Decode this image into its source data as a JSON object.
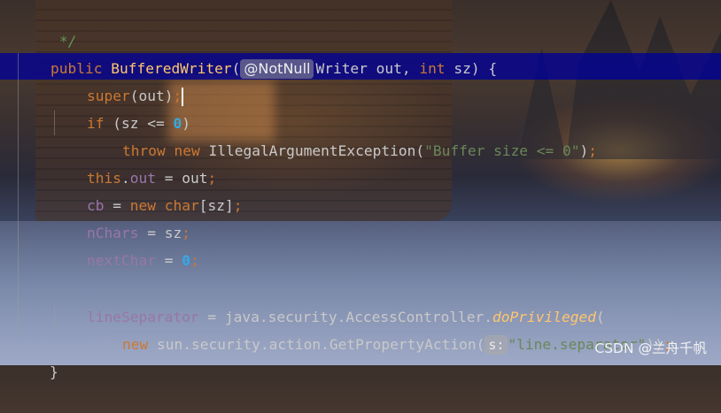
{
  "editor": {
    "comment_end": "*/",
    "line_constructor": {
      "kw_public": "public",
      "name": "BufferedWriter",
      "open_paren": "(",
      "annotation": "@NotNull",
      "param1": "Writer out, ",
      "kw_int": "int",
      "param2": " sz) {"
    },
    "line_super": {
      "kw_super": "super",
      "rest": "(out)",
      "semicolon": ";"
    },
    "line_if": {
      "kw_if": "if",
      "mid": " (sz <= ",
      "num": "0",
      "close": ")"
    },
    "line_throw": {
      "kw_throw": "throw",
      "kw_new": "new",
      "cls": " IllegalArgumentException(",
      "str": "\"Buffer size <= 0\"",
      "close": ")",
      "semicolon": ";"
    },
    "line_this": {
      "kw_this": "this",
      "dot": ".",
      "field": "out",
      "rest": " = out",
      "semicolon": ";"
    },
    "line_cb": {
      "field": "cb",
      "eq": " = ",
      "kw_new": "new",
      "kw_char": " char",
      "rest": "[sz]",
      "semicolon": ";"
    },
    "line_nchars": {
      "field": "nChars",
      "rest": " = sz",
      "semicolon": ";"
    },
    "line_nextchar": {
      "field": "nextChar",
      "eq": " = ",
      "num": "0",
      "semicolon": ";"
    },
    "line_linesep": {
      "field": "lineSeparator",
      "rest": " = java.security.AccessController.",
      "method": "doPrivileged",
      "open": "("
    },
    "line_newaction": {
      "kw_new": "new",
      "rest": " sun.security.action.GetPropertyAction(",
      "hint": "s:",
      "str": "\"line.separator\"",
      "close": "))",
      "semicolon": ";"
    },
    "closing_brace": "}"
  },
  "watermark": "CSDN @兰舟千帆",
  "colors": {
    "keyword": "#cc7832",
    "method": "#ffc66d",
    "field": "#9876aa",
    "number": "#34a9e6",
    "string": "#6a8759",
    "line_highlight": "#000096"
  }
}
